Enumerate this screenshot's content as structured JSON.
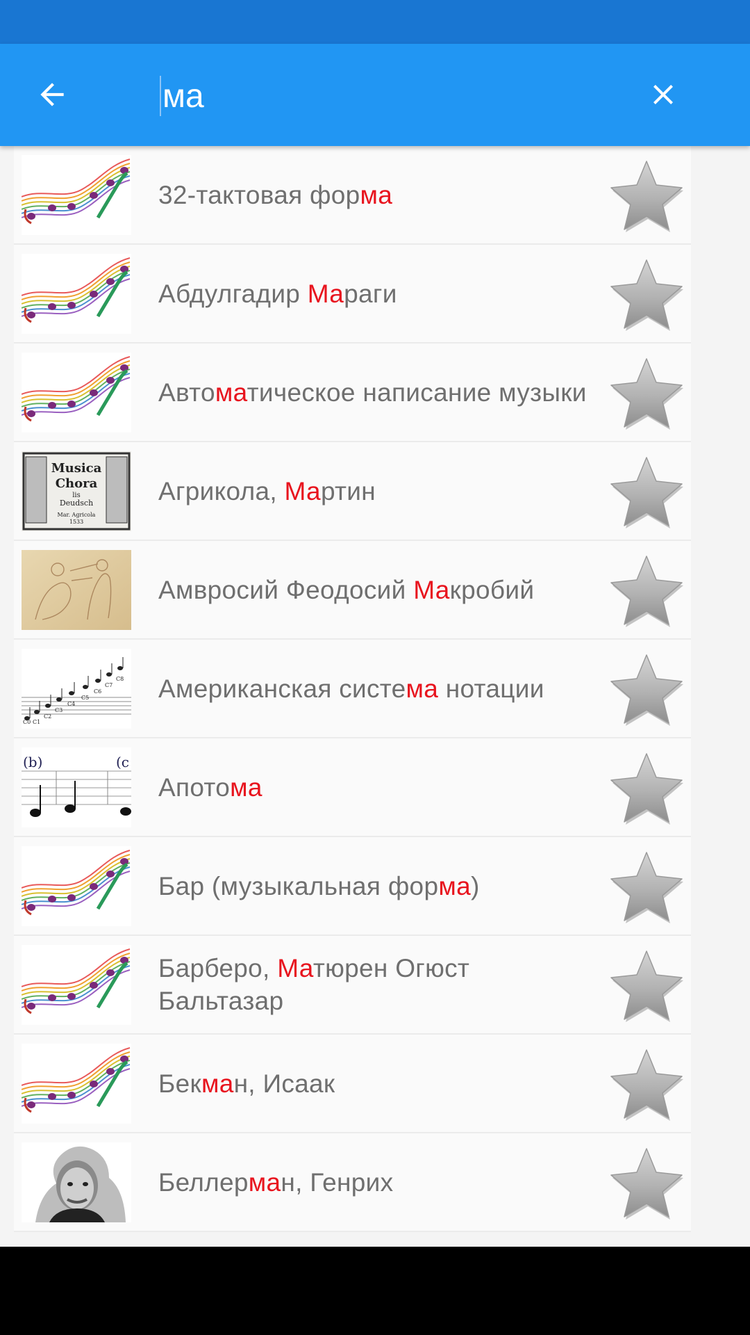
{
  "search": {
    "query": "ма"
  },
  "results": [
    {
      "pre": "32-тактовая фор",
      "hl": "ма",
      "post": "",
      "thumb": "notes"
    },
    {
      "pre": "Абдулгадир ",
      "hl": "Ма",
      "post": "раги",
      "thumb": "notes"
    },
    {
      "pre": "Авто",
      "hl": "ма",
      "post": "тическое написание музыки",
      "thumb": "notes"
    },
    {
      "pre": "Агрикола, ",
      "hl": "Ма",
      "post": "ртин",
      "thumb": "engraving"
    },
    {
      "pre": "Амвросий Феодосий ",
      "hl": "Ма",
      "post": "кробий",
      "thumb": "sketch"
    },
    {
      "pre": "Американская систе",
      "hl": "ма",
      "post": " нотации",
      "thumb": "scale"
    },
    {
      "pre": "Апото",
      "hl": "ма",
      "post": "",
      "thumb": "staff"
    },
    {
      "pre": "Бар (музыкальная фор",
      "hl": "ма",
      "post": ")",
      "thumb": "notes"
    },
    {
      "pre": "Барберо, ",
      "hl": "Ма",
      "post": "тюрен Огюст Бальтазар",
      "thumb": "notes"
    },
    {
      "pre": "Бек",
      "hl": "ма",
      "post": "н, Исаак",
      "thumb": "notes"
    },
    {
      "pre": "Беллер",
      "hl": "ма",
      "post": "н, Генрих",
      "thumb": "portrait"
    }
  ],
  "thumb_texts": {
    "engraving": [
      "Musica",
      "Chora",
      "lis",
      "Deudsch",
      "Mar. Agricola",
      "1533"
    ],
    "scale": [
      "C0",
      "C1",
      "C2",
      "C3",
      "C4",
      "C5",
      "C6",
      "C7",
      "C8"
    ],
    "staff": [
      "(b)",
      "(c"
    ]
  },
  "colors": {
    "status_bar": "#1976d2",
    "app_bar": "#2196f3",
    "highlight": "#e8141e",
    "title_text": "#6f6f6f"
  },
  "icons": {
    "back": "arrow-left-icon",
    "clear": "close-icon",
    "favorite": "star-icon"
  }
}
